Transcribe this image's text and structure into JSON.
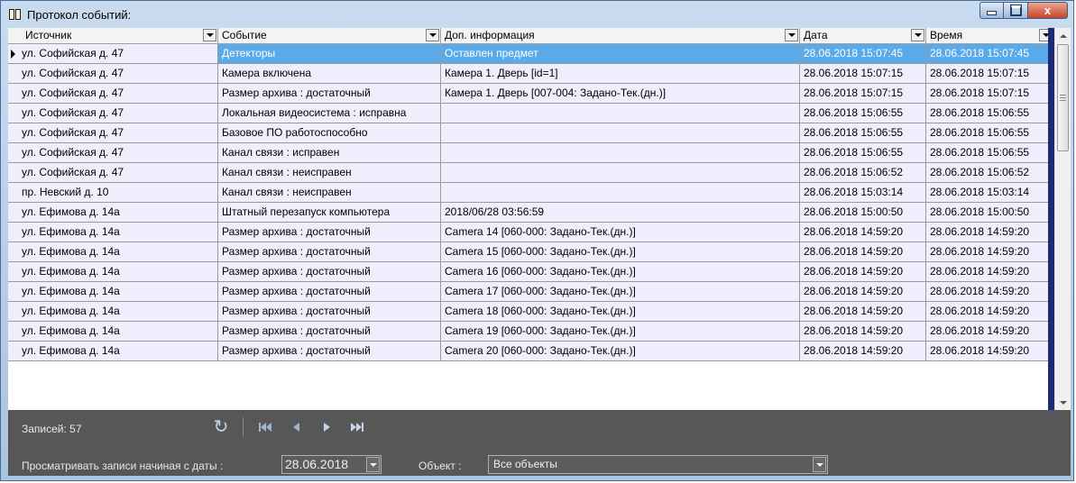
{
  "window": {
    "title": "Протокол событий:",
    "icon": "log-book-icon",
    "buttons": {
      "minimize": "minimize-icon",
      "maximize": "maximize-icon",
      "close": "x"
    }
  },
  "table": {
    "columns": [
      "Источник",
      "Событие",
      "Доп. информация",
      "Дата",
      "Время"
    ],
    "rows": [
      [
        "ул. Софийская д. 47",
        "Детекторы",
        "Оставлен предмет",
        "28.06.2018 15:07:45",
        "28.06.2018 15:07:45"
      ],
      [
        "ул. Софийская д. 47",
        "Камера включена",
        "Камера 1. Дверь [id=1]",
        "28.06.2018 15:07:15",
        "28.06.2018 15:07:15"
      ],
      [
        "ул. Софийская д. 47",
        "Размер архива : достаточный",
        "Камера 1. Дверь [007-004: Задано-Тек.(дн.)]",
        "28.06.2018 15:07:15",
        "28.06.2018 15:07:15"
      ],
      [
        "ул. Софийская д. 47",
        "Локальная видеосистема : исправна",
        "",
        "28.06.2018 15:06:55",
        "28.06.2018 15:06:55"
      ],
      [
        "ул. Софийская д. 47",
        "Базовое ПО работоспособно",
        "",
        "28.06.2018 15:06:55",
        "28.06.2018 15:06:55"
      ],
      [
        "ул. Софийская д. 47",
        "Канал связи : исправен",
        "",
        "28.06.2018 15:06:55",
        "28.06.2018 15:06:55"
      ],
      [
        "ул. Софийская д. 47",
        "Канал связи : неисправен",
        "",
        "28.06.2018 15:06:52",
        "28.06.2018 15:06:52"
      ],
      [
        "пр. Невский д. 10",
        "Канал связи : неисправен",
        "",
        "28.06.2018 15:03:14",
        "28.06.2018 15:03:14"
      ],
      [
        "ул. Ефимова д. 14а",
        "Штатный перезапуск компьютера",
        "2018/06/28 03:56:59",
        "28.06.2018 15:00:50",
        "28.06.2018 15:00:50"
      ],
      [
        "ул. Ефимова д. 14а",
        "Размер архива : достаточный",
        "Camera 14 [060-000: Задано-Тек.(дн.)]",
        "28.06.2018 14:59:20",
        "28.06.2018 14:59:20"
      ],
      [
        "ул. Ефимова д. 14а",
        "Размер архива : достаточный",
        "Camera 15 [060-000: Задано-Тек.(дн.)]",
        "28.06.2018 14:59:20",
        "28.06.2018 14:59:20"
      ],
      [
        "ул. Ефимова д. 14а",
        "Размер архива : достаточный",
        "Camera 16 [060-000: Задано-Тек.(дн.)]",
        "28.06.2018 14:59:20",
        "28.06.2018 14:59:20"
      ],
      [
        "ул. Ефимова д. 14а",
        "Размер архива : достаточный",
        "Camera 17 [060-000: Задано-Тек.(дн.)]",
        "28.06.2018 14:59:20",
        "28.06.2018 14:59:20"
      ],
      [
        "ул. Ефимова д. 14а",
        "Размер архива : достаточный",
        "Camera 18 [060-000: Задано-Тек.(дн.)]",
        "28.06.2018 14:59:20",
        "28.06.2018 14:59:20"
      ],
      [
        "ул. Ефимова д. 14а",
        "Размер архива : достаточный",
        "Camera 19 [060-000: Задано-Тек.(дн.)]",
        "28.06.2018 14:59:20",
        "28.06.2018 14:59:20"
      ],
      [
        "ул. Ефимова д. 14а",
        "Размер архива : достаточный",
        "Camera 20 [060-000: Задано-Тек.(дн.)]",
        "28.06.2018 14:59:20",
        "28.06.2018 14:59:20"
      ]
    ],
    "selected_row": 0
  },
  "footer": {
    "records": "Записей: 57",
    "nav_icons": [
      "refresh-icon",
      "first-record-icon",
      "prev-record-icon",
      "next-record-icon",
      "last-record-icon"
    ],
    "date_label": "Просматривать записи начиная с даты :",
    "date_value": "28.06.2018",
    "object_label": "Объект :",
    "object_value": "Все объекты"
  },
  "colors": {
    "selected_row": "#5aa9e9",
    "row_bg": "#efeefc",
    "footer_bg": "#575757",
    "accent_bar": "#1c2a78"
  }
}
